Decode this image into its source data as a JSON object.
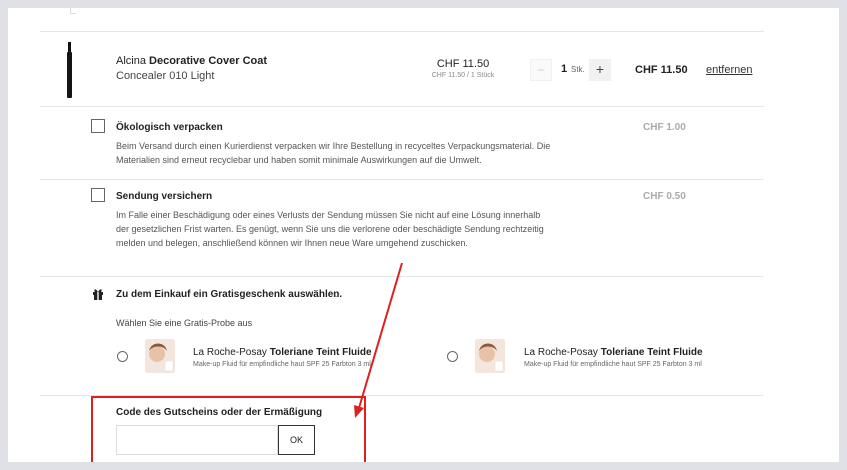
{
  "product": {
    "brand": "Alcina",
    "name": "Decorative Cover Coat",
    "variant": "Concealer 010 Light",
    "unit_price": "CHF 11.50",
    "unit_price_sub": "CHF 11.50 / 1 Stück",
    "qty_minus": "−",
    "qty_value": "1",
    "qty_unit": "Stk.",
    "qty_plus": "+",
    "total_price": "CHF 11.50",
    "remove_label": "entfernen"
  },
  "eco": {
    "title": "Ökologisch verpacken",
    "desc": "Beim Versand durch einen Kurierdienst verpacken wir Ihre Bestellung in recyceltes Verpackungsmaterial. Die Materialien sind erneut recyclebar und haben somit minimale Auswirkungen auf die Umwelt.",
    "price": "CHF 1.00"
  },
  "insurance": {
    "title": "Sendung versichern",
    "desc": "Im Falle einer Beschädigung oder eines Verlusts der Sendung müssen Sie nicht auf eine Lösung innerhalb der gesetzlichen Frist warten. Es genügt, wenn Sie uns die verlorene oder beschädigte Sendung rechtzeitig melden und belegen, anschließend können wir Ihnen neue Ware umgehend zuschicken.",
    "price": "CHF 0.50"
  },
  "gift": {
    "title": "Zu dem Einkauf ein Gratisgeschenk auswählen.",
    "chevron": "⌵",
    "subtitle": "Wählen Sie eine Gratis-Probe aus",
    "samples": [
      {
        "brand": "La Roche-Posay",
        "name": "Toleriane Teint Fluide",
        "desc": "Make-up Fluid für empfindliche haut SPF 25 Farbton 3 ml"
      },
      {
        "brand": "La Roche-Posay",
        "name": "Toleriane Teint Fluide",
        "desc": "Make-up Fluid für empfindliche haut SPF 25 Farbton 3 ml"
      }
    ]
  },
  "voucher": {
    "label": "Code des Gutscheins oder der Ermäßigung",
    "placeholder": "",
    "ok_label": "OK"
  },
  "colors": {
    "highlight": "#e02020",
    "muted_price": "#aaaaaa"
  }
}
